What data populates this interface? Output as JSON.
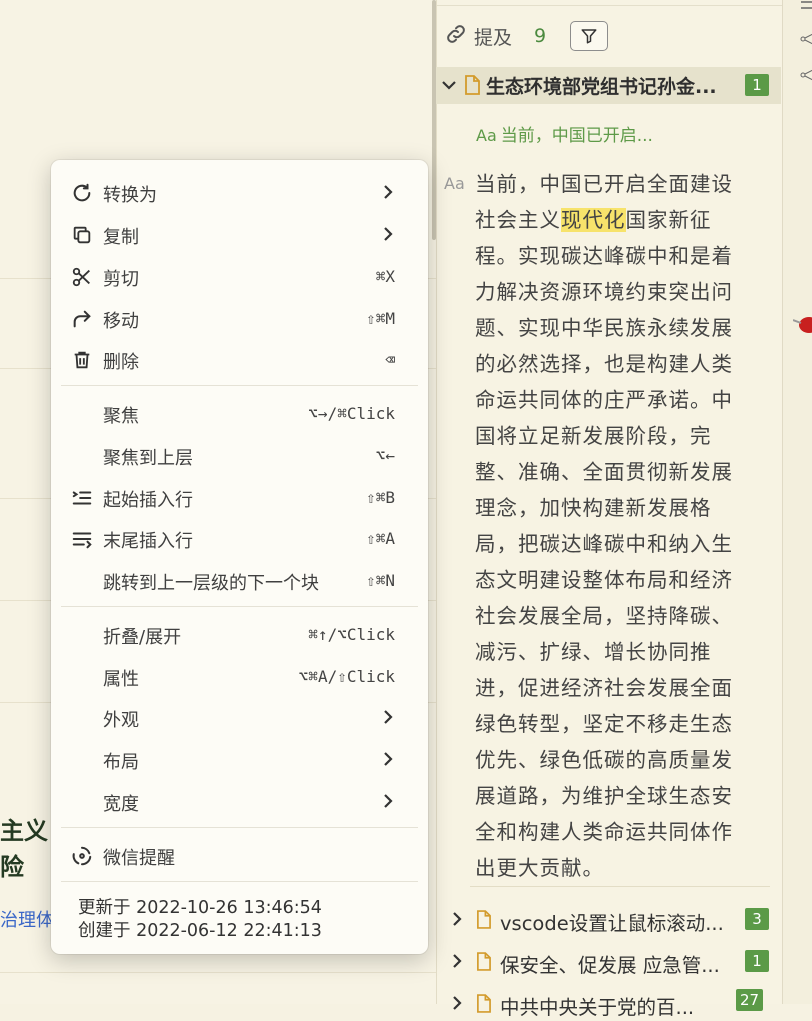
{
  "document": {
    "heading_line1": "主义",
    "heading_line2": "险",
    "link_text": "治理体"
  },
  "mentions": {
    "label": "提及",
    "count": "9",
    "filter_icon": "filter-icon"
  },
  "references": {
    "expanded": {
      "title": "生态环境部党组书记孙金...",
      "count": "1",
      "breadcrumb": "当前，中国已开启...",
      "breadcrumb_prefix": "Aa",
      "block_prefix": "Aa",
      "paragraph_lines": [
        "当前，中国已开启全面建设",
        "社会主义",
        "程。实现碳达峰碳中和是着",
        "力解决资源环境约束突出问",
        "题、实现中华民族永续发展",
        "的必然选择，也是构建人类",
        "命运共同体的庄严承诺。中",
        "国将立足新发展阶段，完",
        "整、准确、全面贯彻新发展",
        "理念，加快构建新发展格",
        "局，把碳达峰碳中和纳入生",
        "态文明建设整体布局和经济",
        "社会发展全局，坚持降碳、",
        "减污、扩绿、增长协同推",
        "进，促进经济社会发展全面",
        "绿色转型，坚定不移走生态",
        "优先、绿色低碳的高质量发",
        "展道路，为维护全球生态安",
        "全和构建人类命运共同体作",
        "出更大贡献。"
      ],
      "highlight": "现代化",
      "line2_tail": "国家新征"
    },
    "collapsed": [
      {
        "title": "vscode设置让鼠标滚动...",
        "count": "3"
      },
      {
        "title": "保安全、促发展 应急管...",
        "count": "1"
      },
      {
        "title": "中共中央关于党的百...",
        "count": "27"
      }
    ]
  },
  "context_menu": {
    "groups": [
      [
        {
          "label": "转换为",
          "icon": "refresh-icon",
          "submenu": true,
          "shortcut": ""
        },
        {
          "label": "复制",
          "icon": "copy-icon",
          "submenu": true,
          "shortcut": ""
        },
        {
          "label": "剪切",
          "icon": "scissors-icon",
          "submenu": false,
          "shortcut": "⌘X"
        },
        {
          "label": "移动",
          "icon": "move-arrow-icon",
          "submenu": false,
          "shortcut": "⇧⌘M"
        },
        {
          "label": "删除",
          "icon": "trash-icon",
          "submenu": false,
          "shortcut": "⌫"
        }
      ],
      [
        {
          "label": "聚焦",
          "icon": "",
          "submenu": false,
          "shortcut": "⌥→/⌘Click"
        },
        {
          "label": "聚焦到上层",
          "icon": "",
          "submenu": false,
          "shortcut": "⌥←"
        },
        {
          "label": "起始插入行",
          "icon": "insert-before-icon",
          "submenu": false,
          "shortcut": "⇧⌘B"
        },
        {
          "label": "末尾插入行",
          "icon": "insert-after-icon",
          "submenu": false,
          "shortcut": "⇧⌘A"
        },
        {
          "label": "跳转到上一层级的下一个块",
          "icon": "",
          "submenu": false,
          "shortcut": "⇧⌘N"
        }
      ],
      [
        {
          "label": "折叠/展开",
          "icon": "",
          "submenu": false,
          "shortcut": "⌘↑/⌥Click"
        },
        {
          "label": "属性",
          "icon": "",
          "submenu": false,
          "shortcut": "⌥⌘A/⇧Click"
        },
        {
          "label": "外观",
          "icon": "",
          "submenu": true,
          "shortcut": ""
        },
        {
          "label": "布局",
          "icon": "",
          "submenu": true,
          "shortcut": ""
        },
        {
          "label": "宽度",
          "icon": "",
          "submenu": true,
          "shortcut": ""
        }
      ],
      [
        {
          "label": "微信提醒",
          "icon": "wechat-reminder-icon",
          "submenu": false,
          "shortcut": ""
        }
      ]
    ],
    "updated": "更新于 2022-10-26 13:46:54",
    "created": "创建于 2022-06-12 22:41:13"
  },
  "colors": {
    "accent_green": "#5b9a47",
    "highlight_yellow": "#f7e36b",
    "link_blue": "#3a67c8"
  }
}
